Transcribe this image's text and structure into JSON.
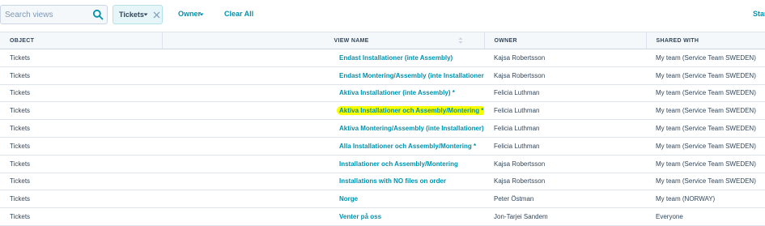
{
  "toolbar": {
    "search_placeholder": "Search views",
    "search_icon": "search-icon",
    "chip_label": "Tickets",
    "owner_label": "Owner",
    "clear_all_label": "Clear All",
    "right_link_label": "Star"
  },
  "table": {
    "headers": [
      "OBJECT",
      "VIEW NAME",
      "OWNER",
      "SHARED WITH"
    ],
    "rows": [
      {
        "object": "Tickets",
        "view_name": "Endast Installationer (inte Assembly)",
        "owner": "Kajsa Robertsson",
        "shared_with": "My team (Service Team SWEDEN)"
      },
      {
        "object": "Tickets",
        "view_name": "Endast Montering/Assembly (inte Installationer)",
        "owner": "Kajsa Robertsson",
        "shared_with": "My team (Service Team SWEDEN)"
      },
      {
        "object": "Tickets",
        "view_name": "Aktiva Installationer (inte Assembly) *",
        "owner": "Felicia Luthman",
        "shared_with": "My team (Service Team SWEDEN)"
      },
      {
        "object": "Tickets",
        "view_name": "Aktiva Installationer och Assembly/Montering *",
        "owner": "Felicia Luthman",
        "shared_with": "My team (Service Team SWEDEN)",
        "highlighted": true
      },
      {
        "object": "Tickets",
        "view_name": "Aktiva Montering/Assembly (inte Installationer) *",
        "owner": "Felicia Luthman",
        "shared_with": "My team (Service Team SWEDEN)"
      },
      {
        "object": "Tickets",
        "view_name": "Alla Installationer och Assembly/Montering *",
        "owner": "Felicia Luthman",
        "shared_with": "My team (Service Team SWEDEN)"
      },
      {
        "object": "Tickets",
        "view_name": "Installationer och Assembly/Montering",
        "owner": "Kajsa Robertsson",
        "shared_with": "My team (Service Team SWEDEN)"
      },
      {
        "object": "Tickets",
        "view_name": "Installations with NO files on order",
        "owner": "Kajsa Robertsson",
        "shared_with": "My team (Service Team SWEDEN)"
      },
      {
        "object": "Tickets",
        "view_name": "Norge",
        "owner": "Peter Östman",
        "shared_with": "My team (NORWAY)"
      },
      {
        "object": "Tickets",
        "view_name": "Venter på oss",
        "owner": "Jon-Tarjei Sandem",
        "shared_with": "Everyone"
      }
    ]
  },
  "colors": {
    "link": "#0091ae",
    "text": "#33475b",
    "highlight": "#f7ff00",
    "chip_bg": "#e5f5f8"
  }
}
